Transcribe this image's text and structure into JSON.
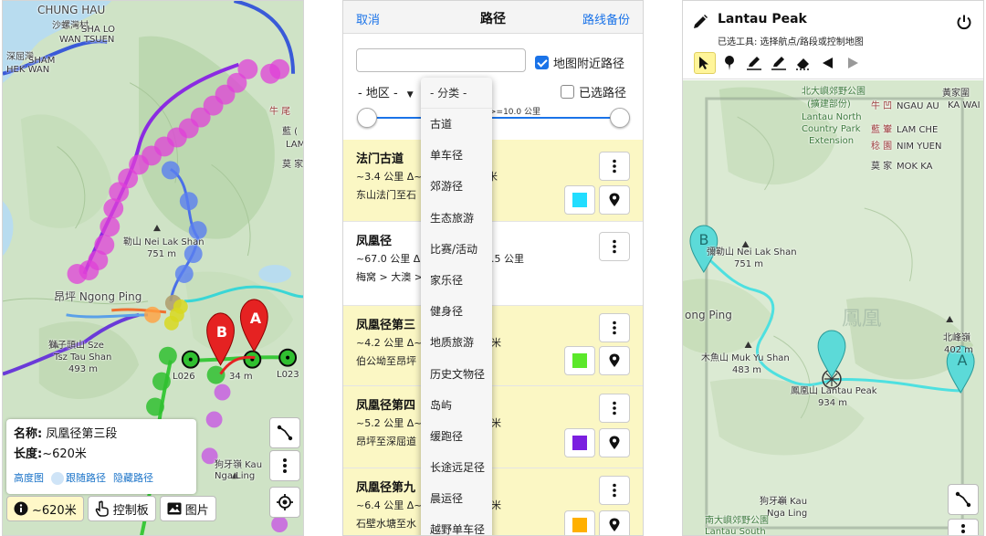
{
  "panel1": {
    "map_labels": [
      {
        "text": "CHUNG HAU",
        "cls": "big"
      },
      {
        "text": "沙螺灣村",
        "cls": ""
      },
      {
        "text": "SHA LO",
        "cls": ""
      },
      {
        "text": "WAN TSUEN",
        "cls": ""
      },
      {
        "text": "深屈灣",
        "cls": ""
      },
      {
        "text": "SHAM",
        "cls": ""
      },
      {
        "text": "HEK WAN",
        "cls": ""
      },
      {
        "text": "牛 尾",
        "cls": "red"
      },
      {
        "text": "藍 (",
        "cls": ""
      },
      {
        "text": "LAM",
        "cls": ""
      },
      {
        "text": "莫 家",
        "cls": ""
      },
      {
        "text": "勒山 Nei Lak Shan",
        "cls": ""
      },
      {
        "text": "751 m",
        "cls": ""
      },
      {
        "text": "昂坪 Ngong Ping",
        "cls": "big"
      },
      {
        "text": "獅子頭山 Sze",
        "cls": ""
      },
      {
        "text": "Tsz Tau Shan",
        "cls": ""
      },
      {
        "text": "493 m",
        "cls": ""
      },
      {
        "text": "L026",
        "cls": ""
      },
      {
        "text": "L023",
        "cls": ""
      },
      {
        "text": "34 m",
        "cls": ""
      },
      {
        "text": "狗牙嶺 Kau",
        "cls": ""
      },
      {
        "text": "Nga Ling",
        "cls": ""
      }
    ],
    "markers": {
      "a": "A",
      "b": "B"
    },
    "info": {
      "name_label": "名称:",
      "name_value": "凤凰径第三段",
      "length_label": "长度:",
      "length_value": "~620米",
      "link1": "高度图",
      "link2": "跟随路径",
      "link3": "隐藏路径"
    },
    "bottom": {
      "length": "~620米",
      "control": "控制板",
      "images": "图片"
    }
  },
  "panel2": {
    "header": {
      "cancel": "取消",
      "title": "路径",
      "backup": "路线备份"
    },
    "search": {
      "placeholder": "",
      "value": ""
    },
    "nearby": {
      "label": "地图附近路径",
      "checked": true
    },
    "region": "- 地区 -",
    "selected": {
      "label": "已选路径",
      "checked": false
    },
    "range_label": ">=10.0 公里",
    "dropdown": {
      "header": "- 分类 -",
      "items": [
        "古道",
        "单车径",
        "郊游径",
        "生态旅游",
        "比赛/活动",
        "家乐径",
        "健身径",
        "地质旅游",
        "历史文物径",
        "岛屿",
        "缓跑径",
        "长途远足径",
        "晨运径",
        "越野单车径"
      ]
    },
    "routes": [
      {
        "title": "法门古道",
        "line1": "~3.4 公里 Δ~",
        "line1b": "米",
        "line2": "东山法门至石",
        "color": "#22ddff",
        "yellow": true
      },
      {
        "title": "凤凰径",
        "line1": "~67.0 公里 Δ~",
        "line1b": ".5 公里",
        "line2": "梅窝 > 大澳 >",
        "color": "",
        "yellow": false
      },
      {
        "title": "凤凰径第三",
        "line1": "~4.2 公里 Δ~",
        "line1b": "米",
        "line2": "伯公坳至昂坪",
        "color": "#5be82a",
        "yellow": true
      },
      {
        "title": "凤凰径第四",
        "line1": "~5.2 公里 Δ~",
        "line1b": "米",
        "line2": "昂坪至深屈道",
        "color": "#7b1fe0",
        "yellow": true
      },
      {
        "title": "凤凰径第九",
        "line1": "~6.4 公里 Δ~",
        "line1b": "米",
        "line2": "石壁水塘至水",
        "color": "#ffb000",
        "yellow": true
      }
    ]
  },
  "panel3": {
    "title": "Lantau Peak",
    "subtitle": "已选工具: 选择航点/路段或控制地图",
    "map_labels": [
      {
        "text": "北大嶼郊野公園",
        "cls": "green"
      },
      {
        "text": "(擴建部份)",
        "cls": "green"
      },
      {
        "text": "Lantau North",
        "cls": "green"
      },
      {
        "text": "Country Park",
        "cls": "green"
      },
      {
        "text": "Extension",
        "cls": "green"
      },
      {
        "text": "黃家圍",
        "cls": ""
      },
      {
        "text": "KA WAI",
        "cls": ""
      },
      {
        "text": "牛 凹",
        "cls": "red"
      },
      {
        "text": "NGAU AU",
        "cls": ""
      },
      {
        "text": "藍 輋",
        "cls": "red"
      },
      {
        "text": "LAM CHE",
        "cls": ""
      },
      {
        "text": "稔 園",
        "cls": "red"
      },
      {
        "text": "NIM YUEN",
        "cls": ""
      },
      {
        "text": "莫 家",
        "cls": ""
      },
      {
        "text": "MOK KA",
        "cls": ""
      },
      {
        "text": "彌勒山 Nei Lak Shan",
        "cls": ""
      },
      {
        "text": "751 m",
        "cls": ""
      },
      {
        "text": "ong Ping",
        "cls": "big"
      },
      {
        "text": "北峰嶺",
        "cls": ""
      },
      {
        "text": "402 m",
        "cls": ""
      },
      {
        "text": "木魚山 Muk Yu Shan",
        "cls": ""
      },
      {
        "text": "483 m",
        "cls": ""
      },
      {
        "text": "鳳凰山 Lantau Peak",
        "cls": ""
      },
      {
        "text": "934 m",
        "cls": ""
      },
      {
        "text": "狗牙嶺 Kau",
        "cls": ""
      },
      {
        "text": "Nga Ling",
        "cls": ""
      },
      {
        "text": "南大嶼郊野公園",
        "cls": "green"
      },
      {
        "text": "Lantau South",
        "cls": "green"
      }
    ],
    "markers": {
      "a": "A",
      "b": "B"
    }
  }
}
